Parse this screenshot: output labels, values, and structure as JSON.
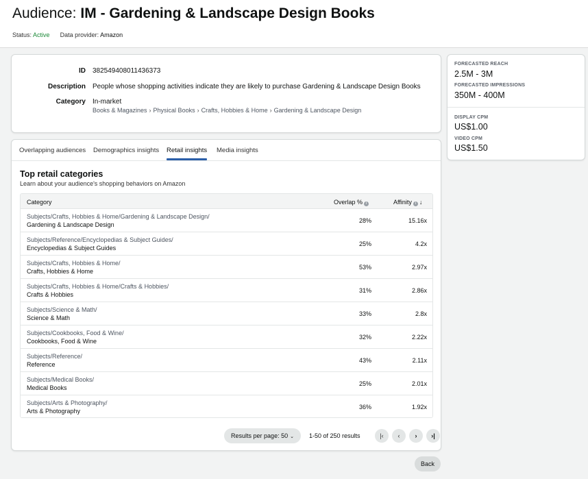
{
  "header": {
    "title_prefix": "Audience:",
    "title_name": "IM - Gardening & Landscape Design Books",
    "status_label": "Status:",
    "status_value": "Active",
    "provider_label": "Data provider:",
    "provider_value": "Amazon"
  },
  "details": {
    "id_label": "ID",
    "id_value": "382549408011436373",
    "description_label": "Description",
    "description_value": "People whose shopping activities indicate they are likely to purchase Gardening & Landscape Design Books",
    "category_label": "Category",
    "category_value": "In-market",
    "breadcrumb": [
      "Books & Magazines",
      "Physical Books",
      "Crafts, Hobbies & Home",
      "Gardening & Landscape Design"
    ]
  },
  "forecast": {
    "reach_label": "FORECASTED REACH",
    "reach_value": "2.5M - 3M",
    "impressions_label": "FORECASTED IMPRESSIONS",
    "impressions_value": "350M - 400M",
    "display_cpm_label": "DISPLAY CPM",
    "display_cpm_value": "US$1.00",
    "video_cpm_label": "VIDEO CPM",
    "video_cpm_value": "US$1.50"
  },
  "tabs": [
    {
      "label": "Overlapping audiences",
      "active": false
    },
    {
      "label": "Demographics insights",
      "active": false
    },
    {
      "label": "Retail insights",
      "active": true
    },
    {
      "label": "Media insights",
      "active": false
    }
  ],
  "retail": {
    "title": "Top retail categories",
    "subtitle": "Learn about your audience's shopping behaviors on Amazon",
    "columns": {
      "category": "Category",
      "overlap": "Overlap %",
      "affinity": "Affinity"
    },
    "rows": [
      {
        "path": "Subjects/Crafts, Hobbies & Home/Gardening & Landscape Design/",
        "name": "Gardening & Landscape Design",
        "overlap": "28%",
        "affinity": "15.16x"
      },
      {
        "path": "Subjects/Reference/Encyclopedias & Subject Guides/",
        "name": "Encyclopedias & Subject Guides",
        "overlap": "25%",
        "affinity": "4.2x"
      },
      {
        "path": "Subjects/Crafts, Hobbies & Home/",
        "name": "Crafts, Hobbies & Home",
        "overlap": "53%",
        "affinity": "2.97x"
      },
      {
        "path": "Subjects/Crafts, Hobbies & Home/Crafts & Hobbies/",
        "name": "Crafts & Hobbies",
        "overlap": "31%",
        "affinity": "2.86x"
      },
      {
        "path": "Subjects/Science & Math/",
        "name": "Science & Math",
        "overlap": "33%",
        "affinity": "2.8x"
      },
      {
        "path": "Subjects/Cookbooks, Food & Wine/",
        "name": "Cookbooks, Food & Wine",
        "overlap": "32%",
        "affinity": "2.22x"
      },
      {
        "path": "Subjects/Reference/",
        "name": "Reference",
        "overlap": "43%",
        "affinity": "2.11x"
      },
      {
        "path": "Subjects/Medical Books/",
        "name": "Medical Books",
        "overlap": "25%",
        "affinity": "2.01x"
      },
      {
        "path": "Subjects/Arts & Photography/",
        "name": "Arts & Photography",
        "overlap": "36%",
        "affinity": "1.92x"
      }
    ]
  },
  "pagination": {
    "results_per_page": "Results per page: 50",
    "range_text": "1-50 of 250 results"
  },
  "actions": {
    "back_label": "Back"
  }
}
